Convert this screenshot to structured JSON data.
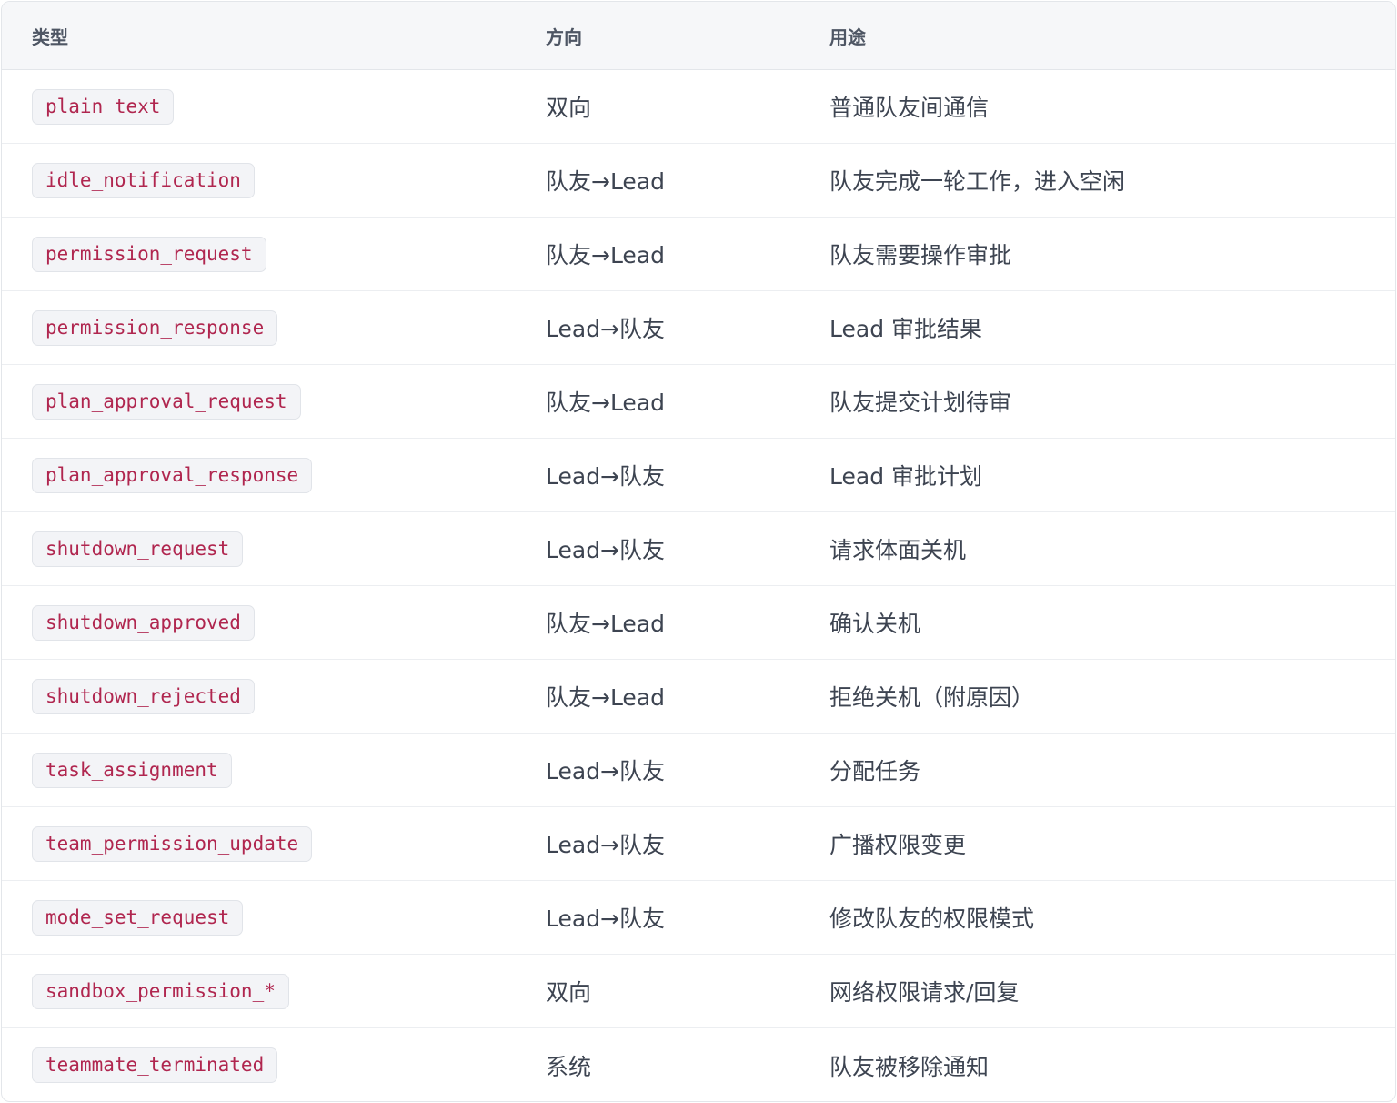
{
  "table": {
    "headers": {
      "type": "类型",
      "direction": "方向",
      "purpose": "用途"
    },
    "rows": [
      {
        "type": "plain text",
        "direction": "双向",
        "purpose": "普通队友间通信"
      },
      {
        "type": "idle_notification",
        "direction": "队友→Lead",
        "purpose": "队友完成一轮工作，进入空闲"
      },
      {
        "type": "permission_request",
        "direction": "队友→Lead",
        "purpose": "队友需要操作审批"
      },
      {
        "type": "permission_response",
        "direction": "Lead→队友",
        "purpose": "Lead 审批结果"
      },
      {
        "type": "plan_approval_request",
        "direction": "队友→Lead",
        "purpose": "队友提交计划待审"
      },
      {
        "type": "plan_approval_response",
        "direction": "Lead→队友",
        "purpose": "Lead 审批计划"
      },
      {
        "type": "shutdown_request",
        "direction": "Lead→队友",
        "purpose": "请求体面关机"
      },
      {
        "type": "shutdown_approved",
        "direction": "队友→Lead",
        "purpose": "确认关机"
      },
      {
        "type": "shutdown_rejected",
        "direction": "队友→Lead",
        "purpose": "拒绝关机（附原因）"
      },
      {
        "type": "task_assignment",
        "direction": "Lead→队友",
        "purpose": "分配任务"
      },
      {
        "type": "team_permission_update",
        "direction": "Lead→队友",
        "purpose": "广播权限变更"
      },
      {
        "type": "mode_set_request",
        "direction": "Lead→队友",
        "purpose": "修改队友的权限模式"
      },
      {
        "type": "sandbox_permission_*",
        "direction": "双向",
        "purpose": "网络权限请求/回复"
      },
      {
        "type": "teammate_terminated",
        "direction": "系统",
        "purpose": "队友被移除通知"
      }
    ]
  }
}
